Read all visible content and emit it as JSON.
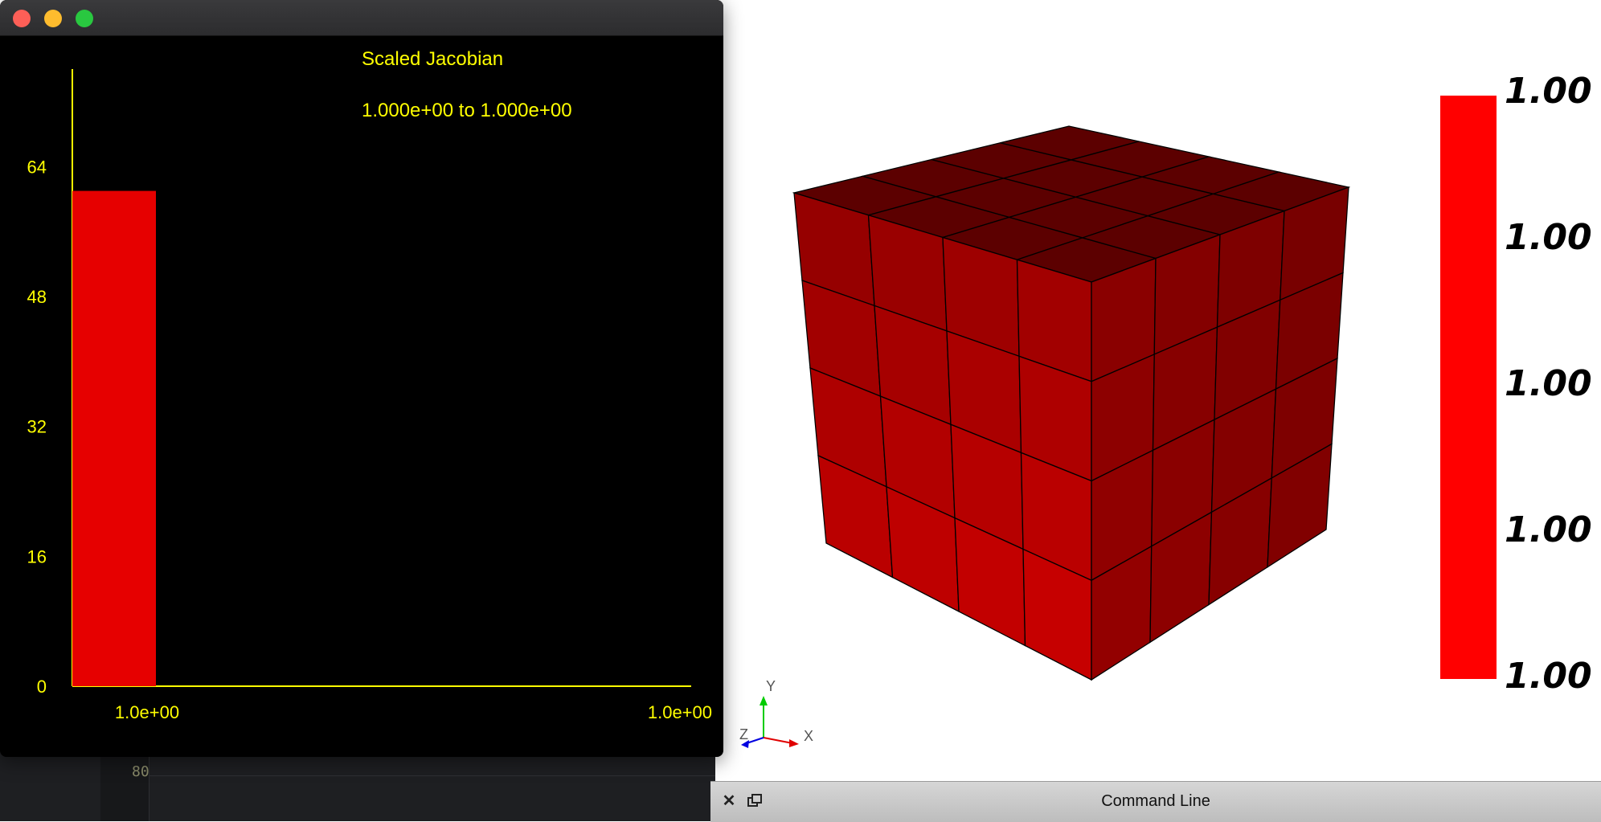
{
  "histogram_window": {
    "traffic_lights": [
      "close",
      "minimize",
      "maximize"
    ]
  },
  "chart_data": {
    "type": "bar",
    "title": "Scaled Jacobian",
    "subtitle": "1.000e+00 to 1.000e+00",
    "categories": [
      "1.0e+00"
    ],
    "values": [
      61
    ],
    "x_tick_labels": [
      "1.0e+00",
      "1.0e+00"
    ],
    "y_ticks": [
      0,
      16,
      32,
      48,
      64
    ],
    "ylim": [
      0,
      76
    ],
    "bar_color": "#e60000",
    "axis_color": "#ffff00",
    "background": "#000000",
    "grid": false
  },
  "viewport": {
    "cube_color": "#8b0000",
    "axes": {
      "y_label": "Y",
      "x_label": "X",
      "z_label": "Z"
    },
    "legend": {
      "color": "#ff0000",
      "labels": [
        "1.00",
        "1.00",
        "1.00",
        "1.00",
        "1.00"
      ]
    }
  },
  "background_editor": {
    "line_number": "80"
  },
  "command_bar": {
    "title": "Command Line",
    "close_icon": "close-icon",
    "float_icon": "float-window-icon"
  }
}
